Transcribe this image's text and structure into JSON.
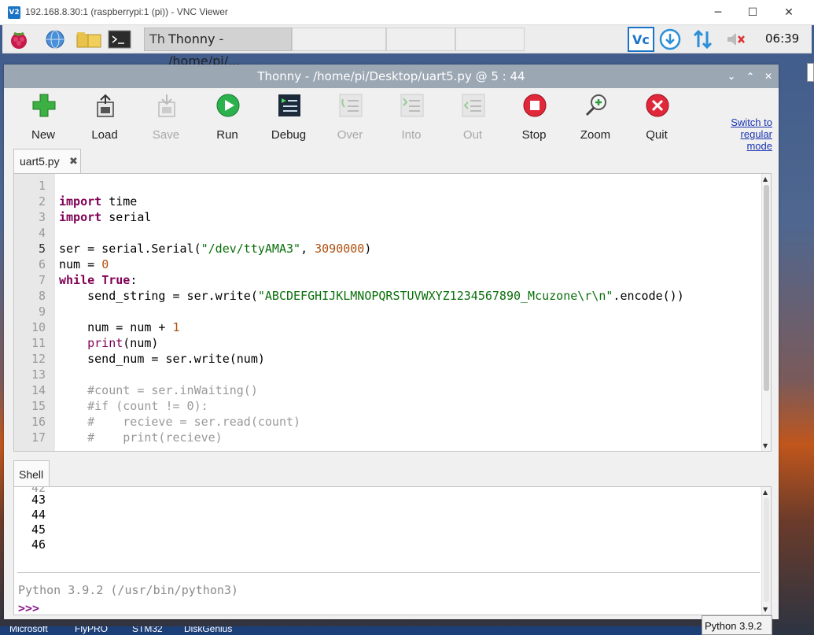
{
  "vnc": {
    "title": "192.168.8.30:1 (raspberrypi:1 (pi)) - VNC Viewer",
    "logo": "V2",
    "minimize": "─",
    "maximize": "☐",
    "close": "✕"
  },
  "taskbar": {
    "window_label": "Thonny  -  /home/pi/...",
    "clock": "06:39",
    "icons": [
      "raspberry-icon",
      "globe-icon",
      "folder-icon",
      "terminal-icon",
      "vnc-icon",
      "download-icon",
      "updown-arrows-icon",
      "volume-muted-icon"
    ]
  },
  "thonny": {
    "title": "Thonny  -  /home/pi/Desktop/uart5.py  @  5 : 44",
    "title_ctl": {
      "menu": "⌄",
      "up": "⌃",
      "close": "✕"
    },
    "toolbar": [
      {
        "label": "New",
        "enabled": true,
        "icon": "new-icon"
      },
      {
        "label": "Load",
        "enabled": true,
        "icon": "load-icon"
      },
      {
        "label": "Save",
        "enabled": false,
        "icon": "save-icon"
      },
      {
        "label": "Run",
        "enabled": true,
        "icon": "run-icon"
      },
      {
        "label": "Debug",
        "enabled": true,
        "icon": "debug-icon"
      },
      {
        "label": "Over",
        "enabled": false,
        "icon": "step-over-icon"
      },
      {
        "label": "Into",
        "enabled": false,
        "icon": "step-into-icon"
      },
      {
        "label": "Out",
        "enabled": false,
        "icon": "step-out-icon"
      },
      {
        "label": "Stop",
        "enabled": true,
        "icon": "stop-icon"
      },
      {
        "label": "Zoom",
        "enabled": true,
        "icon": "zoom-icon"
      },
      {
        "label": "Quit",
        "enabled": true,
        "icon": "quit-icon"
      }
    ],
    "switch_mode": [
      "Switch to",
      "regular",
      "mode"
    ],
    "editor_tab": "uart5.py",
    "editor_tab_close": "✖",
    "line_numbers": [
      "1",
      "2",
      "3",
      "4",
      "5",
      "6",
      "7",
      "8",
      "9",
      "10",
      "11",
      "12",
      "13",
      "14",
      "15",
      "16",
      "17"
    ],
    "code": {
      "l2_kw": "import",
      "l2_rest": " time",
      "l3_kw": "import",
      "l3_rest": " serial",
      "l5_a": "ser = serial.Serial(",
      "l5_str": "\"/dev/ttyAMA3\"",
      "l5_b": ", ",
      "l5_num": "3090000",
      "l5_c": ")",
      "l6_a": "num = ",
      "l6_num": "0",
      "l7_kw": "while",
      "l7_sp": " ",
      "l7_kw2": "True",
      "l7_c": ":",
      "l8_a": "    send_string = ser.write(",
      "l8_str": "\"ABCDEFGHIJKLMNOPQRSTUVWXYZ1234567890_Mcuzone\\r\\n\"",
      "l8_b": ".encode())",
      "l10_a": "    num = num + ",
      "l10_num": "1",
      "l11_a": "    ",
      "l11_fn": "print",
      "l11_b": "(num)",
      "l12": "    send_num = ser.write(num)",
      "l14": "    #count = ser.inWaiting()",
      "l15": "    #if (count != 0):",
      "l16": "    #    recieve = ser.read(count)",
      "l17": "    #    print(recieve)"
    },
    "shell_tab": "Shell",
    "shell_lines": [
      "43",
      "44",
      "45",
      "46"
    ],
    "shell_version": "Python 3.9.2 (/usr/bin/python3)",
    "shell_prompt": ">>>",
    "status_interpreter": "Python 3.9.2"
  },
  "windows_taskbar": [
    "Microsoft",
    "FlyPRO",
    "STM32",
    "DiskGenius"
  ],
  "colors": {
    "keyword": "#7f0055",
    "string": "#0a6f0a",
    "number": "#b05010",
    "comment": "#999999",
    "title_bg": "#9ba7b3"
  }
}
